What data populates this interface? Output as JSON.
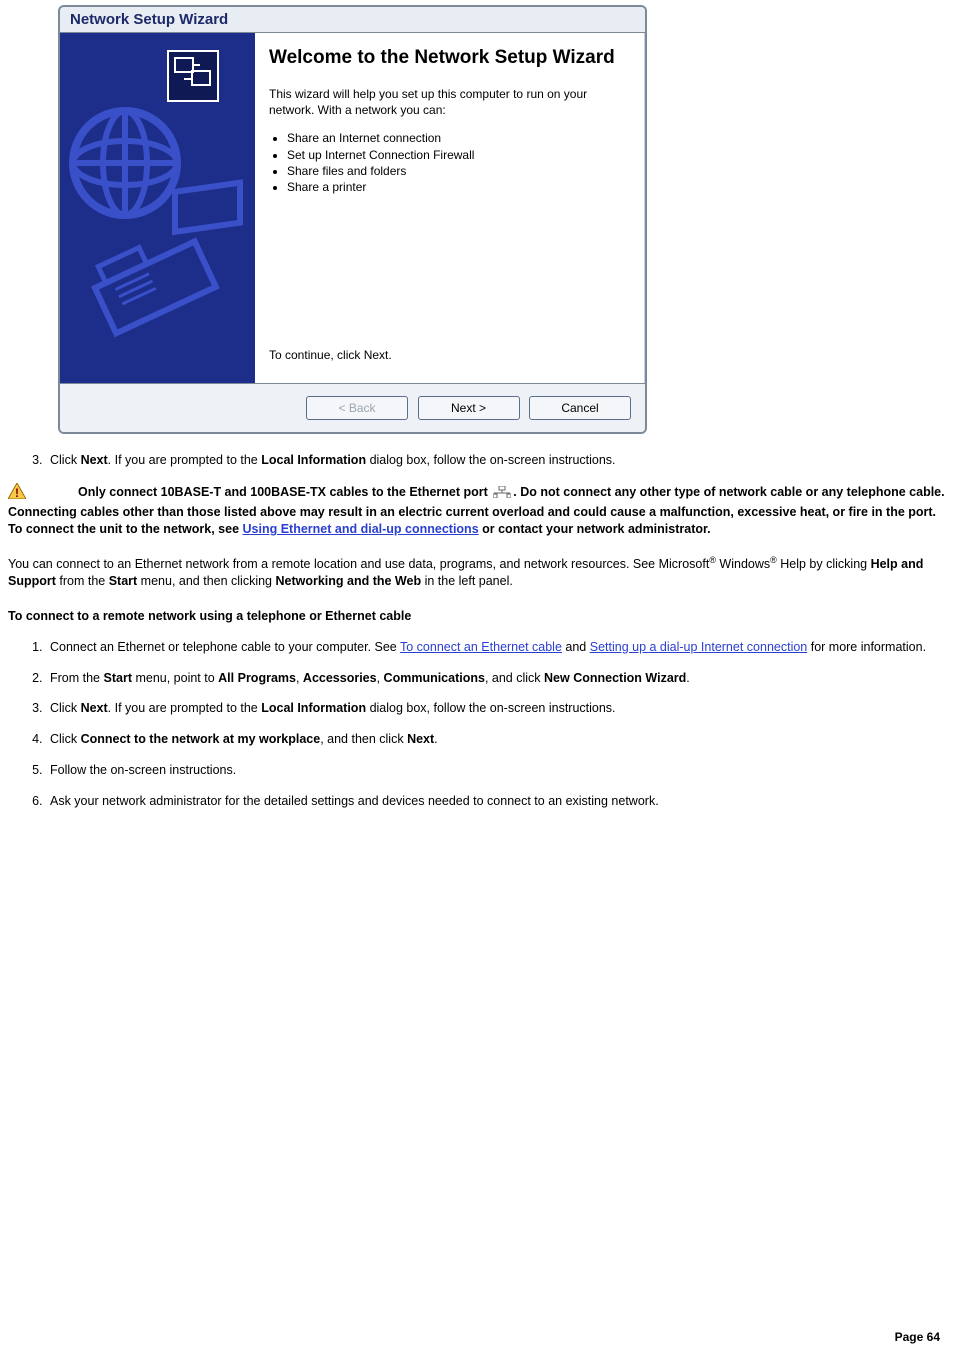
{
  "wizard": {
    "title": "Network Setup Wizard",
    "heading": "Welcome to the Network Setup Wizard",
    "intro": "This wizard will help you set up this computer to run on your network. With a network you can:",
    "bullets": [
      "Share an Internet connection",
      "Set up Internet Connection Firewall",
      "Share files and folders",
      "Share a printer"
    ],
    "continue": "To continue, click Next.",
    "buttons": {
      "back": "< Back",
      "next": "Next >",
      "cancel": "Cancel"
    }
  },
  "doc": {
    "step3_a": "Click ",
    "step3_b": "Next",
    "step3_c": ". If you are prompted to the ",
    "step3_d": "Local Information",
    "step3_e": " dialog box, follow the on-screen instructions.",
    "warn_a": "Only connect 10BASE-T and 100BASE-TX cables to the Ethernet port ",
    "warn_b": ". Do not connect any other type of network cable or any telephone cable. Connecting cables other than those listed above may result in an electric current overload and could cause a malfunction, excessive heat, or fire in the port. To connect the unit to the network, see ",
    "warn_link": "Using Ethernet and dial-up connections",
    "warn_c": " or contact your network administrator.",
    "para_a": "You can connect to an Ethernet network from a remote location and use data, programs, and network resources. See Microsoft",
    "para_b": " Windows",
    "para_c": " Help by clicking ",
    "para_d": "Help and Support",
    "para_e": " from the ",
    "para_f": "Start",
    "para_g": " menu, and then clicking ",
    "para_h": "Networking and the Web",
    "para_i": " in the left panel.",
    "section_heading": "To connect to a remote network using a telephone or Ethernet cable",
    "s1_a": "Connect an Ethernet or telephone cable to your computer. See ",
    "s1_link1": "To connect an Ethernet cable",
    "s1_b": " and ",
    "s1_link2": "Setting up a dial-up Internet connection",
    "s1_c": " for more information.",
    "s2_a": "From the ",
    "s2_b": "Start",
    "s2_c": " menu, point to ",
    "s2_d": "All Programs",
    "s2_e": ", ",
    "s2_f": "Accessories",
    "s2_g": ", ",
    "s2_h": "Communications",
    "s2_i": ", and click ",
    "s2_j": "New Connection Wizard",
    "s2_k": ".",
    "s4_a": "Click ",
    "s4_b": "Connect to the network at my workplace",
    "s4_c": ", and then click ",
    "s4_d": "Next",
    "s4_e": ".",
    "s5": "Follow the on-screen instructions.",
    "s6": "Ask your network administrator for the detailed settings and devices needed to connect to an existing network.",
    "page": "Page 64"
  }
}
